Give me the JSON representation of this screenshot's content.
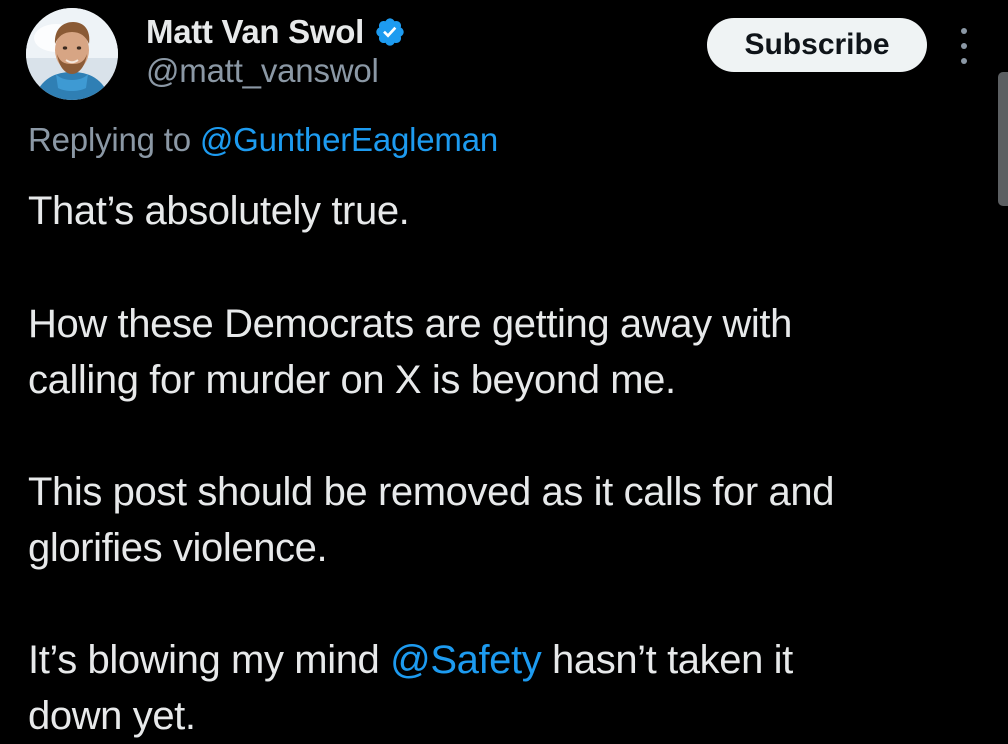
{
  "author": {
    "display_name": "Matt Van Swol",
    "handle": "@matt_vanswol",
    "verified_icon": "verified-badge-icon",
    "avatar_icon": "avatar-photo"
  },
  "header": {
    "subscribe_label": "Subscribe",
    "more_icon": "more-vertical-icon"
  },
  "reply": {
    "label": "Replying to",
    "target": "@GuntherEagleman"
  },
  "body": {
    "p1": "That’s absolutely true.",
    "p2_line1": "How these Democrats are getting away with",
    "p2_line2": "calling for murder on X is beyond me.",
    "p3_line1": "This post should be removed as it calls for and",
    "p3_line2": "glorifies violence.",
    "p4_before": "It’s blowing my mind ",
    "p4_mention": "@Safety",
    "p4_after": " hasn’t taken it",
    "p4_line2": "down yet."
  },
  "colors": {
    "background": "#000000",
    "text": "#e7e9ea",
    "secondary": "#8b98a5",
    "link": "#1d9bf0",
    "button_bg": "#eff3f4",
    "verified": "#1d9bf0"
  }
}
